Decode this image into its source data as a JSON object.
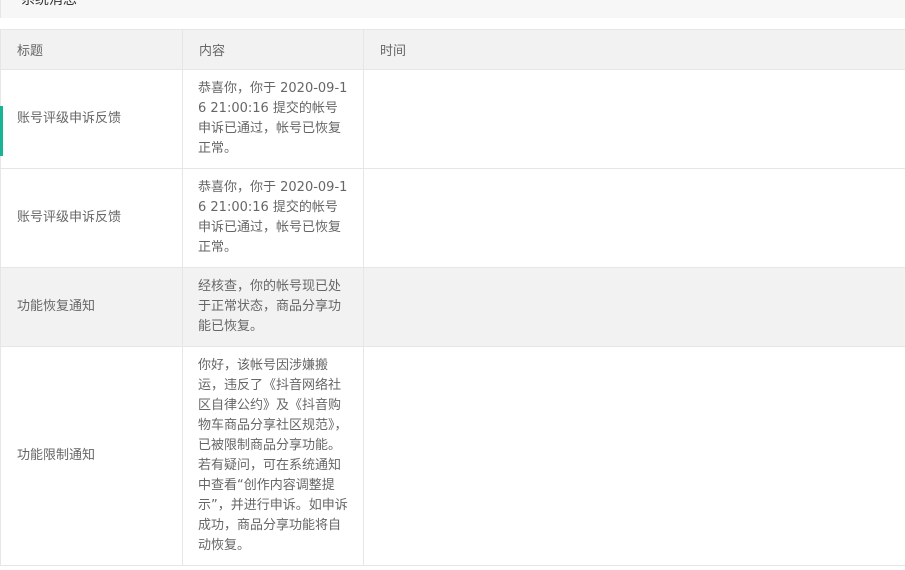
{
  "section": {
    "title": "系统消息"
  },
  "table": {
    "headers": {
      "title": "标题",
      "content": "内容",
      "time": "时间"
    },
    "rows": [
      {
        "title": "账号评级申诉反馈",
        "content": "恭喜你，你于 2020-09-16 21:00:16 提交的帐号申诉已通过，帐号已恢复正常。",
        "time": ""
      },
      {
        "title": "账号评级申诉反馈",
        "content": "恭喜你，你于 2020-09-16 21:00:16 提交的帐号申诉已通过，帐号已恢复正常。",
        "time": ""
      },
      {
        "title": "功能恢复通知",
        "content": "经核查，你的帐号现已处于正常状态，商品分享功能已恢复。",
        "time": ""
      },
      {
        "title": "功能限制通知",
        "content": "你好，该帐号因涉嫌搬运，违反了《抖音网络社区自律公约》及《抖音购物车商品分享社区规范》，已被限制商品分享功能。若有疑问，可在系统通知中查看“创作内容调整提示”，并进行申诉。如申诉成功，商品分享功能将自动恢复。",
        "time": ""
      }
    ]
  },
  "colors": {
    "accent": "#1ab394",
    "header_bg": "#f2f2f2",
    "border": "#e6e6e6",
    "text": "#666666"
  }
}
